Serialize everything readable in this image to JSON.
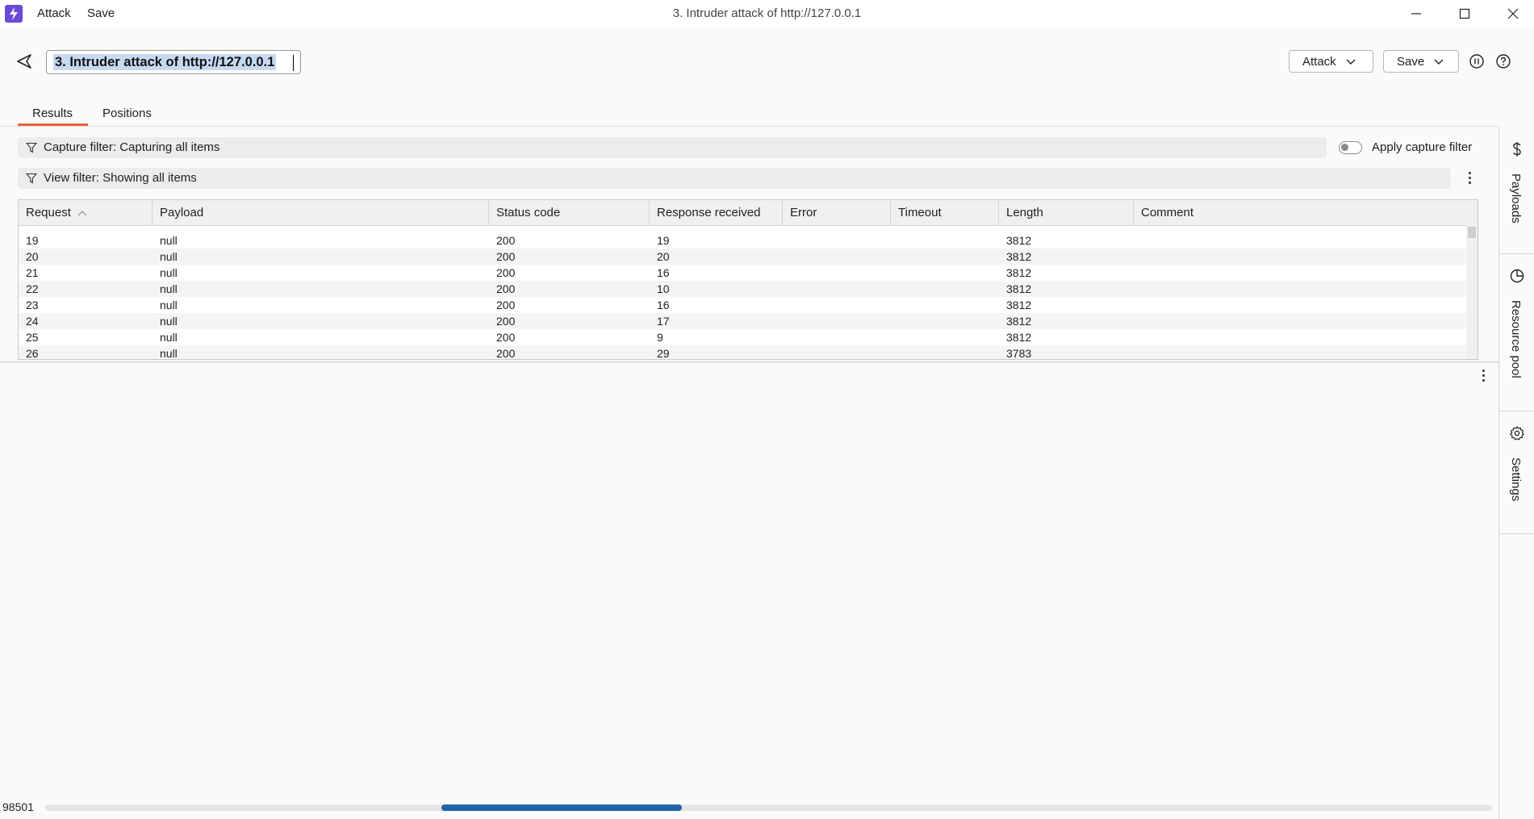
{
  "window": {
    "title": "3. Intruder attack of http://127.0.0.1",
    "menu": [
      "Attack",
      "Save"
    ]
  },
  "header": {
    "attack_name": "3. Intruder attack of http://127.0.0.1",
    "attack_button": "Attack",
    "save_button": "Save"
  },
  "tabs": [
    {
      "label": "Results",
      "active": true
    },
    {
      "label": "Positions",
      "active": false
    }
  ],
  "filters": {
    "capture": "Capture filter: Capturing all items",
    "view": "View filter: Showing all items",
    "apply_capture_label": "Apply capture filter",
    "apply_capture_on": false
  },
  "table": {
    "columns": [
      "Request",
      "Payload",
      "Status code",
      "Response received",
      "Error",
      "Timeout",
      "Length",
      "Comment"
    ],
    "sort_column": "Request",
    "sort_direction": "ascending",
    "rows": [
      [
        "19",
        "null",
        "200",
        "19",
        "",
        "",
        "3812",
        ""
      ],
      [
        "20",
        "null",
        "200",
        "20",
        "",
        "",
        "3812",
        ""
      ],
      [
        "21",
        "null",
        "200",
        "16",
        "",
        "",
        "3812",
        ""
      ],
      [
        "22",
        "null",
        "200",
        "10",
        "",
        "",
        "3812",
        ""
      ],
      [
        "23",
        "null",
        "200",
        "16",
        "",
        "",
        "3812",
        ""
      ],
      [
        "24",
        "null",
        "200",
        "17",
        "",
        "",
        "3812",
        ""
      ],
      [
        "25",
        "null",
        "200",
        "9",
        "",
        "",
        "3812",
        ""
      ],
      [
        "26",
        "null",
        "200",
        "29",
        "",
        "",
        "3783",
        ""
      ]
    ]
  },
  "sidebar": {
    "items": [
      {
        "label": "Payloads",
        "icon": "dollar-icon"
      },
      {
        "label": "Resource pool",
        "icon": "pie-chart-icon"
      },
      {
        "label": "Settings",
        "icon": "gear-icon"
      }
    ]
  },
  "status": {
    "count": "98501"
  },
  "colors": {
    "accent": "#e8643a",
    "brand": "#6a4bd8",
    "scroll_thumb": "#1f63a8"
  }
}
